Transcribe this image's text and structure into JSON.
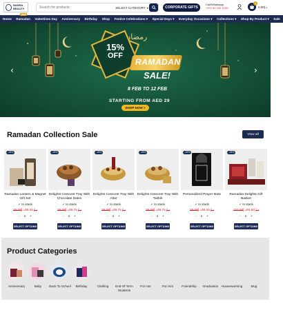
{
  "header": {
    "logo_text": "NASRA BEAUTY",
    "search_placeholder": "Search for products",
    "category_label": "SELECT CATEGORY",
    "corporate_label": "CORPORATE GIFTS",
    "whatsapp_label": "Call/Whatsapp",
    "whatsapp_number": "+971 52 232 5199",
    "cart_count": "0",
    "cart_total": "0.00د.إ"
  },
  "nav": {
    "new_badge": "NEW",
    "items": [
      "Home",
      "Ramadan",
      "Valentines Day",
      "Anniversary",
      "Birthday",
      "Shop",
      "Festive Celebrations ▾",
      "Special Days ▾",
      "Everyday Occasions ▾",
      "Collections ▾",
      "Shop By Product ▾",
      "Sale"
    ]
  },
  "hero": {
    "arabic": "رمضان كريم",
    "percent": "15%",
    "off": "OFF",
    "ramadan": "RAMADAN",
    "sale": "SALE!",
    "dates": "8 FEB TO 12 FEB",
    "starting": "STARTING FROM AED 29",
    "cta": "SHOP NOW >"
  },
  "collection": {
    "title": "Ramadan Collection Sale",
    "view_all": "View all",
    "select_label": "SELECT OPTIONS",
    "in_stock": "✓ In stock",
    "products": [
      {
        "discount": "-15%",
        "name_1": "Ramadan Lantern & Magnet",
        "name_2": "Gift Set",
        "old": "45.00د.إ",
        "new": "38.25د.إ"
      },
      {
        "discount": "-15%",
        "name_1": "Delights Crescent Tray With",
        "name_2": "Chocolate Dates",
        "old": "35.00د.إ",
        "new": "29.75د.إ"
      },
      {
        "discount": "-15%",
        "name_1": "Delights Crescent Tray With",
        "name_2": "Attar",
        "old": "35.00د.إ",
        "new": "29.75د.إ"
      },
      {
        "discount": "-15%",
        "name_1": "Delights Crescent Tray With",
        "name_2": "Tasbih",
        "old": "35.00د.إ",
        "new": "29.75د.إ"
      },
      {
        "discount": "-15%",
        "name_1": "Personalized Prayer Mats",
        "name_2": "",
        "old": "45.00د.إ",
        "new": "38.25د.إ"
      },
      {
        "discount": "-15%",
        "name_1": "Ramadan Delights Gift Basket",
        "name_2": "",
        "old": "110.00د.إ",
        "new": "93.50د.إ"
      }
    ]
  },
  "categories": {
    "title": "Product Categories",
    "items": [
      "Anniversary",
      "Baby",
      "Back To School",
      "Birthday",
      "Clothing",
      "End Of Term Students",
      "For Her",
      "For Him",
      "Friendship",
      "Graduation",
      "Housewarming",
      "Mug"
    ]
  },
  "colors": {
    "navy": "#1b2b52",
    "green": "#124b33",
    "gold": "#e6b93b",
    "price_red": "#d22"
  }
}
